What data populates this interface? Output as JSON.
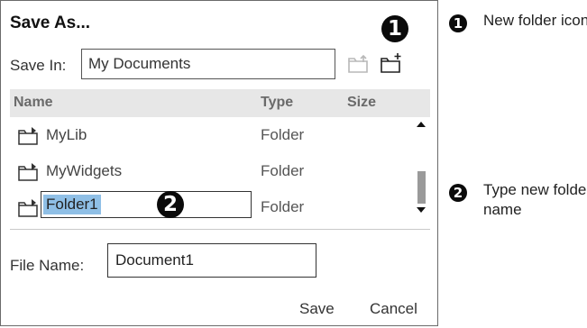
{
  "dialog": {
    "title": "Save As...",
    "save_in": {
      "label": "Save In:",
      "value": "My Documents"
    },
    "columns": {
      "name": "Name",
      "type": "Type",
      "size": "Size"
    },
    "items": [
      {
        "name": "MyLib",
        "type": "Folder"
      },
      {
        "name": "MyWidgets",
        "type": "Folder"
      },
      {
        "name": "Folder1",
        "type": "Folder",
        "editing": true
      }
    ],
    "file_name": {
      "label": "File Name:",
      "value": "Document1"
    },
    "buttons": {
      "save": "Save",
      "cancel": "Cancel"
    }
  },
  "callouts": {
    "one": "1",
    "two": "2"
  },
  "legend": [
    {
      "number": "1",
      "text": "New folder icon"
    },
    {
      "number": "2",
      "text": "Type new folder name"
    }
  ],
  "icons": {
    "parent_folder": "folder-up-icon",
    "new_folder": "new-folder-icon",
    "folder": "folder-icon"
  }
}
